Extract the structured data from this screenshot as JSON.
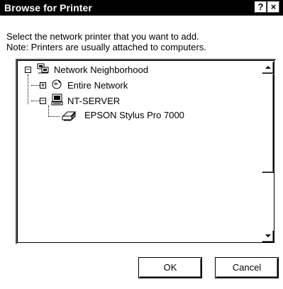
{
  "window": {
    "title": "Browse for Printer",
    "help_glyph": "?",
    "close_glyph": "×"
  },
  "instructions": {
    "line1": "Select the network printer that you want to add.",
    "line2": "Note: Printers are usually attached to computers."
  },
  "tree": {
    "nodes": [
      {
        "label": "Network Neighborhood",
        "icon": "network-neighborhood-icon",
        "expander": "−"
      },
      {
        "label": "Entire Network",
        "icon": "globe-icon",
        "expander": "+"
      },
      {
        "label": "NT-SERVER",
        "icon": "computer-icon",
        "expander": "−"
      },
      {
        "label": "EPSON Stylus Pro 7000",
        "icon": "printer-icon",
        "expander": ""
      }
    ]
  },
  "buttons": {
    "ok": "OK",
    "cancel": "Cancel"
  }
}
